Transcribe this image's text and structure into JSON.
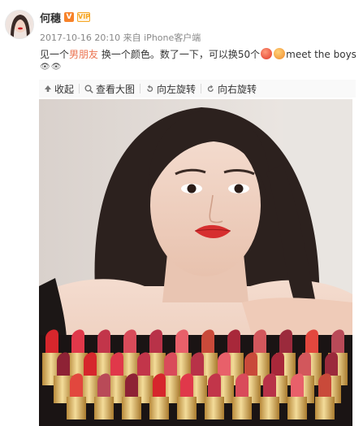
{
  "author": {
    "name": "何穗",
    "verified_mark": "V",
    "member_mark": "VIP"
  },
  "meta": {
    "timestamp": "2017-10-16 20:10",
    "source_prefix": "来自",
    "source": "iPhone客户端"
  },
  "post": {
    "text_before": "见一个",
    "highlight": "男朋友",
    "text_after": " 换一个颜色。数了一下，可以换50个",
    "text_tail": "meet the boys",
    "line2": "👁👁"
  },
  "toolbar": {
    "collapse": "收起",
    "view_large": "查看大图",
    "rotate_left": "向左旋转",
    "rotate_right": "向右旋转"
  },
  "icons": {
    "collapse": "arrow-up-icon",
    "view_large": "magnifier-icon",
    "rotate_left": "rotate-left-icon",
    "rotate_right": "rotate-right-icon"
  },
  "colors": {
    "link": "#eb7350",
    "meta": "#888888",
    "lip": "#d62f2f"
  }
}
